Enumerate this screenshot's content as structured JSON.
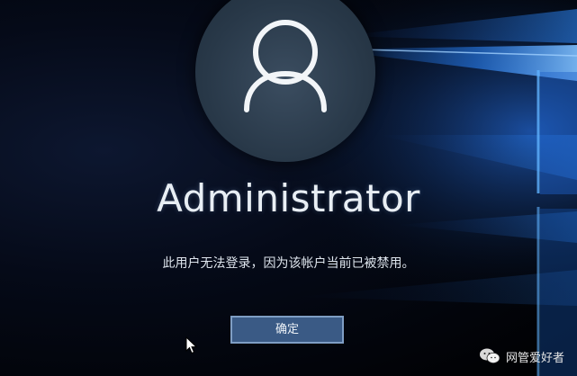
{
  "login": {
    "username": "Administrator",
    "message": "此用户无法登录，因为该帐户当前已被禁用。",
    "ok_label": "确定"
  },
  "icons": {
    "avatar": "user-avatar-icon",
    "cursor": "mouse-pointer-icon",
    "watermark": "wechat-icon"
  },
  "watermark": {
    "text": "网管爱好者"
  },
  "colors": {
    "button_bg": "#3a5a85",
    "button_border": "#7f9ec4",
    "text": "#e8eef4",
    "wallpaper_glow": "#1e6fe0"
  }
}
